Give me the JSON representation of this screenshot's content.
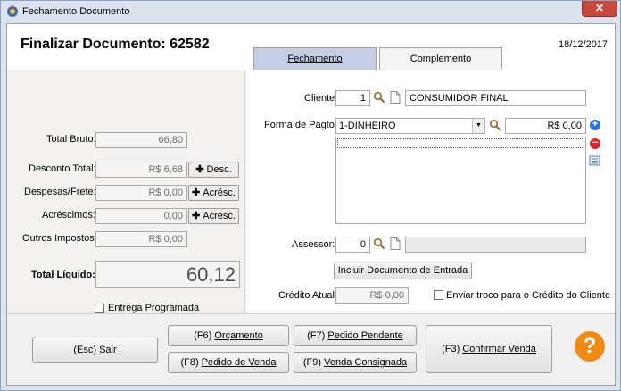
{
  "window": {
    "title": "Fechamento Documento",
    "close_label": "✕"
  },
  "header": {
    "title": "Finalizar Documento: 62582",
    "date": "18/12/2017"
  },
  "tabs": [
    {
      "label": "Fechamento",
      "active": true
    },
    {
      "label": "Complemento",
      "active": false
    }
  ],
  "totals": {
    "total_bruto_label": "Total Bruto:",
    "total_bruto_value": "66,80",
    "desconto_label": "Desconto Total:",
    "desconto_value": "R$ 6,68",
    "desconto_button": "Desc.",
    "despesas_label": "Despesas/Frete:",
    "despesas_value": "R$ 0,00",
    "despesas_button": "Acrésc.",
    "acrescimos_label": "Acréscimos:",
    "acrescimos_value": "0,00",
    "acrescimos_button": "Acrésc.",
    "outros_label": "Outros Impostos:",
    "outros_value": "R$ 0,00",
    "liquido_label": "Total Líquido:",
    "liquido_value": "60,12",
    "entrega_label": "Entrega Programada",
    "entrega_checked": false
  },
  "form": {
    "cliente_label": "Cliente:",
    "cliente_code": "1",
    "cliente_name": "CONSUMIDOR FINAL",
    "pagto_label": "Forma de Pagto:",
    "pagto_value": "1-DINHEIRO",
    "pagto_amount": "R$ 0,00",
    "assessor_label": "Assessor:",
    "assessor_code": "0",
    "assessor_name": "",
    "incluir_button": "Incluir Documento de Entrada",
    "credito_label": "Crédito Atual:",
    "credito_value": "R$ 0,00",
    "troco_label": "Enviar troco para o Crédito do Cliente",
    "troco_checked": false
  },
  "actions": {
    "sair": {
      "key": "(Esc) ",
      "label": "Sair"
    },
    "orcamento": {
      "key": "(F6) ",
      "label": "Orçamento"
    },
    "pedido_pendente": {
      "key": "(F7) ",
      "label": "Pedido Pendente"
    },
    "pedido_venda": {
      "key": "(F8) ",
      "label": "Pedido de Venda"
    },
    "venda_consignada": {
      "key": "(F9) ",
      "label": "Venda Consignada"
    },
    "confirmar": {
      "key": "(F3) ",
      "label": "Confirmar Venda"
    },
    "help_label": "?"
  },
  "colors": {
    "tab_active": "#c5cee4",
    "help": "#f08a16",
    "add_icon": "#2f6fd6",
    "remove_icon": "#d9262b",
    "close": "#c74a3d"
  },
  "icons": {
    "app": "app-icon",
    "search": "magnifier-icon",
    "document": "document-icon",
    "add": "plus-circle-icon",
    "remove": "minus-circle-icon",
    "list": "list-edit-icon",
    "help": "help-icon"
  }
}
